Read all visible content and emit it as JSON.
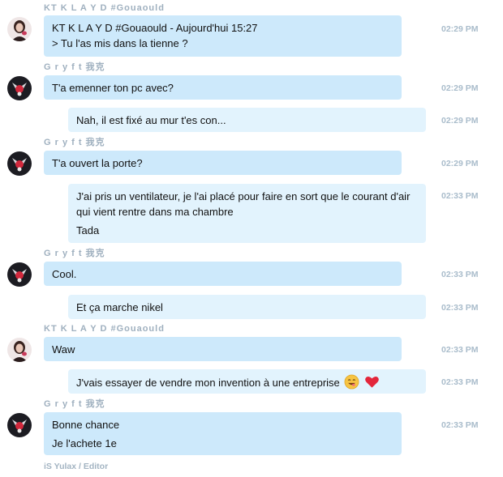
{
  "sender_names": {
    "klayd": "KT  K L A Y D #Gouaould",
    "gryft": "G r y f t 我克"
  },
  "messages": [
    {
      "sender": "KT  K L A Y D #Gouaould",
      "lines": [
        "KT  K L A Y D #Gouaould - Aujourd'hui 15:27",
        "> Tu l'as mis dans la tienne ?"
      ],
      "time": "02:29 PM"
    },
    {
      "sender": "G r y f t 我克",
      "lines": [
        "T'a emenner ton pc avec?"
      ],
      "time": "02:29 PM"
    },
    {
      "lines": [
        "Nah, il est fixé au mur t'es con..."
      ],
      "time": "02:29 PM"
    },
    {
      "sender": "G r y f t 我克",
      "lines": [
        "T'a ouvert la porte?"
      ],
      "time": "02:29 PM"
    },
    {
      "lines": [
        "J'ai pris un ventilateur, je l'ai placé pour faire en sort que le courant d'air",
        "qui vient rentre dans ma chambre",
        "Tada"
      ],
      "time": "02:33 PM"
    },
    {
      "sender": "G r y f t 我克",
      "lines": [
        "Cool."
      ],
      "time": "02:33 PM"
    },
    {
      "lines": [
        "Et ça marche nikel"
      ],
      "time": "02:33 PM"
    },
    {
      "sender": "KT  K L A Y D #Gouaould",
      "lines": [
        "Waw"
      ],
      "time": "02:33 PM"
    },
    {
      "lines": [
        "J'vais essayer de vendre mon invention à une entreprise"
      ],
      "emojis": [
        "smiling-face-emoji",
        "red-heart-emoji"
      ],
      "time": "02:33 PM"
    },
    {
      "sender": "G r y f t 我克",
      "lines": [
        "Bonne chance",
        "Je l'achete 1e"
      ],
      "time": "02:33 PM"
    }
  ],
  "footer": "iS Yulax / Editor",
  "colors": {
    "bubble": "#cde9fb",
    "bubble_continuation": "#e2f3fd",
    "sender_name": "#9fb0bf",
    "timestamp": "#a9bccb"
  }
}
